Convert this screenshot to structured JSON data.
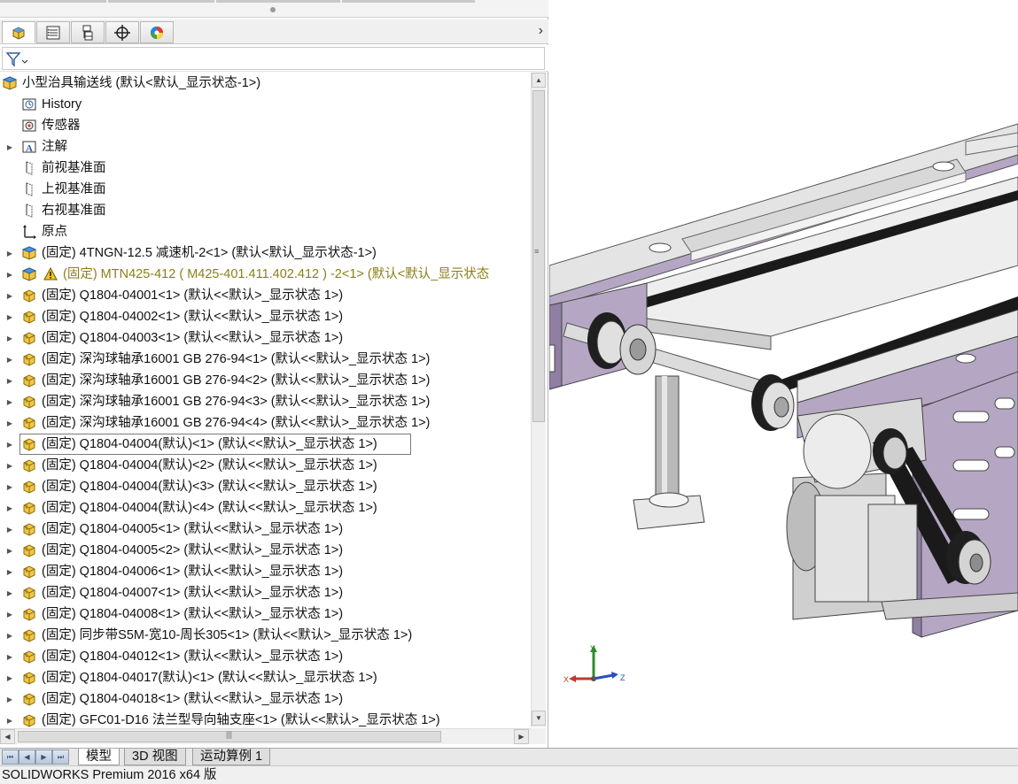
{
  "feature_manager": {
    "tabs": [
      {
        "icon": "feature-manager-icon"
      },
      {
        "icon": "property-manager-icon"
      },
      {
        "icon": "configuration-manager-icon"
      },
      {
        "icon": "dimxpert-icon"
      },
      {
        "icon": "display-manager-icon"
      }
    ],
    "more_glyph": "›",
    "filter_icon": "filter-icon"
  },
  "tree": {
    "root": "小型治具输送线  (默认<默认_显示状态-1>)",
    "items": [
      {
        "label": "History",
        "icon": "history-icon",
        "indent": 1,
        "expander": false,
        "kind": "feature"
      },
      {
        "label": "传感器",
        "icon": "sensor-icon",
        "indent": 1,
        "expander": false,
        "kind": "feature"
      },
      {
        "label": "注解",
        "icon": "annotation-icon",
        "indent": 1,
        "expander": true,
        "kind": "feature"
      },
      {
        "label": "前视基准面",
        "icon": "plane-icon",
        "indent": 1,
        "expander": false,
        "kind": "feature"
      },
      {
        "label": "上视基准面",
        "icon": "plane-icon",
        "indent": 1,
        "expander": false,
        "kind": "feature"
      },
      {
        "label": "右视基准面",
        "icon": "plane-icon",
        "indent": 1,
        "expander": false,
        "kind": "feature"
      },
      {
        "label": "原点",
        "icon": "origin-icon",
        "indent": 1,
        "expander": false,
        "kind": "feature"
      },
      {
        "label": "(固定) 4TNGN-12.5 减速机-2<1> (默认<默认_显示状态-1>)",
        "icon": "assembly-icon",
        "indent": 1,
        "expander": true,
        "kind": "assembly"
      },
      {
        "label": "(固定) MTN425-412 ( M425-401.411.402.412 ) -2<1> (默认<默认_显示状态",
        "icon": "assembly-icon",
        "indent": 1,
        "expander": true,
        "kind": "assembly-warning"
      },
      {
        "label": "(固定) Q1804-04001<1> (默认<<默认>_显示状态 1>)",
        "icon": "part-icon",
        "indent": 1,
        "expander": true,
        "kind": "part"
      },
      {
        "label": "(固定) Q1804-04002<1> (默认<<默认>_显示状态 1>)",
        "icon": "part-icon",
        "indent": 1,
        "expander": true,
        "kind": "part"
      },
      {
        "label": "(固定) Q1804-04003<1> (默认<<默认>_显示状态 1>)",
        "icon": "part-icon",
        "indent": 1,
        "expander": true,
        "kind": "part"
      },
      {
        "label": "(固定) 深沟球轴承16001 GB 276-94<1> (默认<<默认>_显示状态 1>)",
        "icon": "part-icon",
        "indent": 1,
        "expander": true,
        "kind": "part"
      },
      {
        "label": "(固定) 深沟球轴承16001 GB 276-94<2> (默认<<默认>_显示状态 1>)",
        "icon": "part-icon",
        "indent": 1,
        "expander": true,
        "kind": "part"
      },
      {
        "label": "(固定) 深沟球轴承16001 GB 276-94<3> (默认<<默认>_显示状态 1>)",
        "icon": "part-icon",
        "indent": 1,
        "expander": true,
        "kind": "part"
      },
      {
        "label": "(固定) 深沟球轴承16001 GB 276-94<4> (默认<<默认>_显示状态 1>)",
        "icon": "part-icon",
        "indent": 1,
        "expander": true,
        "kind": "part"
      },
      {
        "label": "(固定) Q1804-04004(默认)<1> (默认<<默认>_显示状态 1>)",
        "icon": "part-icon",
        "indent": 1,
        "expander": true,
        "kind": "part-selected"
      },
      {
        "label": "(固定) Q1804-04004(默认)<2> (默认<<默认>_显示状态 1>)",
        "icon": "part-icon",
        "indent": 1,
        "expander": true,
        "kind": "part"
      },
      {
        "label": "(固定) Q1804-04004(默认)<3> (默认<<默认>_显示状态 1>)",
        "icon": "part-icon",
        "indent": 1,
        "expander": true,
        "kind": "part"
      },
      {
        "label": "(固定) Q1804-04004(默认)<4> (默认<<默认>_显示状态 1>)",
        "icon": "part-icon",
        "indent": 1,
        "expander": true,
        "kind": "part"
      },
      {
        "label": "(固定) Q1804-04005<1> (默认<<默认>_显示状态 1>)",
        "icon": "part-icon",
        "indent": 1,
        "expander": true,
        "kind": "part"
      },
      {
        "label": "(固定) Q1804-04005<2> (默认<<默认>_显示状态 1>)",
        "icon": "part-icon",
        "indent": 1,
        "expander": true,
        "kind": "part"
      },
      {
        "label": "(固定) Q1804-04006<1> (默认<<默认>_显示状态 1>)",
        "icon": "part-icon",
        "indent": 1,
        "expander": true,
        "kind": "part"
      },
      {
        "label": "(固定) Q1804-04007<1> (默认<<默认>_显示状态 1>)",
        "icon": "part-icon",
        "indent": 1,
        "expander": true,
        "kind": "part"
      },
      {
        "label": "(固定) Q1804-04008<1> (默认<<默认>_显示状态 1>)",
        "icon": "part-icon",
        "indent": 1,
        "expander": true,
        "kind": "part"
      },
      {
        "label": "(固定) 同步带S5M-宽10-周长305<1> (默认<<默认>_显示状态 1>)",
        "icon": "part-icon",
        "indent": 1,
        "expander": true,
        "kind": "part"
      },
      {
        "label": "(固定) Q1804-04012<1> (默认<<默认>_显示状态 1>)",
        "icon": "part-icon",
        "indent": 1,
        "expander": true,
        "kind": "part"
      },
      {
        "label": "(固定) Q1804-04017(默认)<1> (默认<<默认>_显示状态 1>)",
        "icon": "part-icon",
        "indent": 1,
        "expander": true,
        "kind": "part"
      },
      {
        "label": "(固定) Q1804-04018<1> (默认<<默认>_显示状态 1>)",
        "icon": "part-icon",
        "indent": 1,
        "expander": true,
        "kind": "part"
      },
      {
        "label": "(固定) GFC01-D16 法兰型导向轴支座<1> (默认<<默认>_显示状态 1>)",
        "icon": "part-icon",
        "indent": 1,
        "expander": true,
        "kind": "part"
      }
    ]
  },
  "bottom_tabs": [
    {
      "label": "模型",
      "active": true
    },
    {
      "label": "3D 视图",
      "active": false
    },
    {
      "label": "运动算例 1",
      "active": false
    }
  ],
  "status_bar": {
    "text": "SOLIDWORKS Premium 2016 x64 版"
  },
  "triad": {
    "x": "X",
    "y": "Y",
    "z": "Z"
  },
  "colors": {
    "plate_purple": "#b5a7c4",
    "plate_dark": "#8f7fa3",
    "metal_gray": "#d0d0d0",
    "belt_black": "#1a1a1a",
    "part_yellow": "#f2c744",
    "warning_olive": "#8c7f18"
  }
}
